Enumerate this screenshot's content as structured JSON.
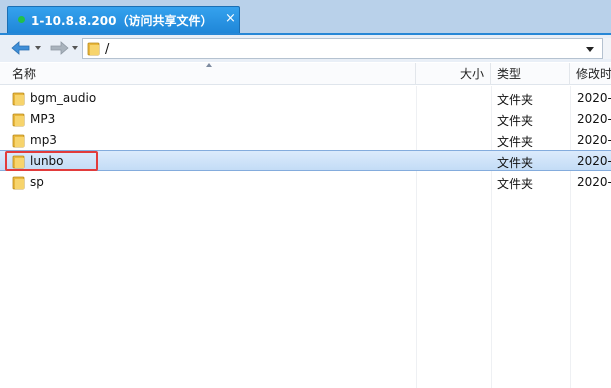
{
  "tab": {
    "title": "1-10.8.8.200（访问共享文件）",
    "close": "×"
  },
  "address": {
    "path": "/"
  },
  "columns": {
    "name": "名称",
    "size": "大小",
    "type": "类型",
    "modified": "修改时"
  },
  "files": [
    {
      "name": "bgm_audio",
      "type": "文件夹",
      "date": "2020-0"
    },
    {
      "name": "MP3",
      "type": "文件夹",
      "date": "2020-0"
    },
    {
      "name": "mp3",
      "type": "文件夹",
      "date": "2020-0"
    },
    {
      "name": "lunbo",
      "type": "文件夹",
      "date": "2020-0"
    },
    {
      "name": "sp",
      "type": "文件夹",
      "date": "2020-0"
    }
  ],
  "selected_index": 3,
  "icons": [
    "folder-icon",
    "back-arrow-icon",
    "forward-arrow-icon",
    "dropdown-icon",
    "close-icon",
    "status-dot-icon"
  ],
  "colors": {
    "tab": "#2a95e3",
    "selection": "#cfe3f8",
    "highlight": "#e23b3b"
  }
}
